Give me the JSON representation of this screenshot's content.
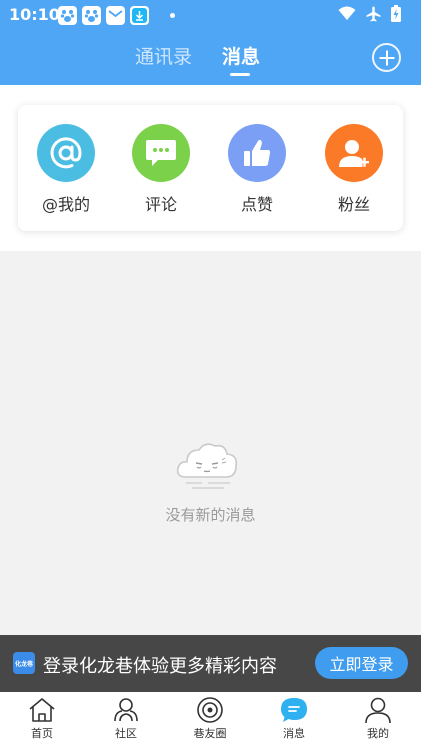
{
  "status_bar": {
    "time": "10:10"
  },
  "tabs": [
    {
      "label": "通讯录"
    },
    {
      "label": "消息"
    }
  ],
  "quick_actions": [
    {
      "label": "@我的",
      "icon": "at-icon",
      "color": "#4bbde3"
    },
    {
      "label": "评论",
      "icon": "comment-icon",
      "color": "#7cd14a"
    },
    {
      "label": "点赞",
      "icon": "thumbs-up-icon",
      "color": "#7a9ff5"
    },
    {
      "label": "粉丝",
      "icon": "user-add-icon",
      "color": "#fb7a27"
    }
  ],
  "empty_state": {
    "text": "没有新的消息"
  },
  "login_banner": {
    "logo_text": "化龙巷",
    "text": "登录化龙巷体验更多精彩内容",
    "button": "立即登录"
  },
  "bottom_nav": [
    {
      "label": "首页",
      "icon": "home-icon"
    },
    {
      "label": "社区",
      "icon": "community-icon"
    },
    {
      "label": "巷友圈",
      "icon": "moments-icon"
    },
    {
      "label": "消息",
      "icon": "message-icon",
      "active": true,
      "active_color": "#2fb0f0"
    },
    {
      "label": "我的",
      "icon": "profile-icon"
    }
  ],
  "colors": {
    "header": "#4ea6f5",
    "banner": "#474747",
    "login_button": "#3f9cee"
  }
}
